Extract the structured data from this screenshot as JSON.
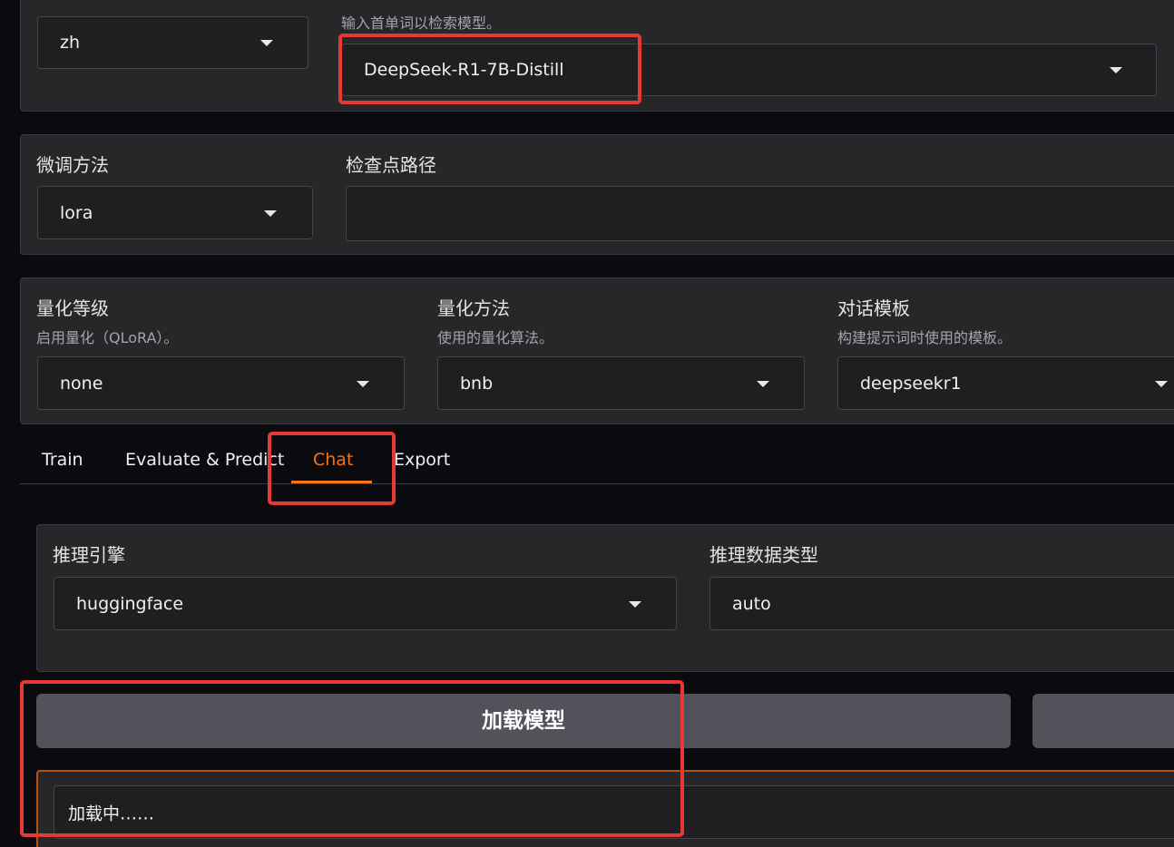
{
  "top": {
    "lang_value": "zh",
    "model_info": "输入首单词以检索模型。",
    "model_value": "DeepSeek-R1-7B-Distill"
  },
  "finetune": {
    "method_label": "微调方法",
    "method_value": "lora",
    "checkpoint_label": "检查点路径",
    "checkpoint_value": ""
  },
  "quant": {
    "bit_label": "量化等级",
    "bit_info": "启用量化（QLoRA）。",
    "bit_value": "none",
    "method_label": "量化方法",
    "method_info": "使用的量化算法。",
    "method_value": "bnb",
    "template_label": "对话模板",
    "template_info": "构建提示词时使用的模板。",
    "template_value": "deepseekr1"
  },
  "tabs": [
    {
      "label": "Train",
      "active": false
    },
    {
      "label": "Evaluate & Predict",
      "active": false
    },
    {
      "label": "Chat",
      "active": true
    },
    {
      "label": "Export",
      "active": false
    }
  ],
  "chat": {
    "engine_label": "推理引擎",
    "engine_value": "huggingface",
    "dtype_label": "推理数据类型",
    "dtype_value": "auto",
    "load_button": "加载模型",
    "unload_button": "",
    "status_text": "加载中……"
  },
  "colors": {
    "accent": "#f97316",
    "highlight_box": "#e53935",
    "panel_bg": "#27272a",
    "page_bg": "#0b0b0f"
  }
}
